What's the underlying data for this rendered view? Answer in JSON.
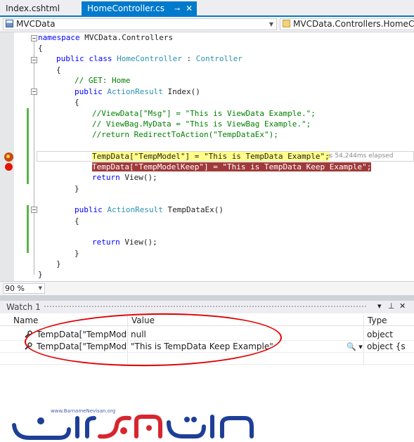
{
  "tabs": {
    "inactive_label": "Index.cshtml",
    "active_label": "HomeController.cs",
    "pin_glyph": "⊸",
    "close_glyph": "✕"
  },
  "navbar": {
    "project": "MVCData",
    "type_member": "MVCData.Controllers.HomeController"
  },
  "code": {
    "l1_kw": "namespace",
    "l1_rest": " MVCData.Controllers",
    "l2": "{",
    "l3_kw": "public class",
    "l3_ty": "HomeController",
    "l3_sep": " : ",
    "l3_base": "Controller",
    "l4": "{",
    "l5": "// GET: Home",
    "l6_kw": "public",
    "l6_ty": "ActionResult",
    "l6_rest": " Index()",
    "l7": "{",
    "l8": "//ViewData[\"Msg\"] = \"This is ViewData Example.\";",
    "l9": "// ViewBag.MyData = \"This is ViewBag Example.\";",
    "l10": "//return RedirectToAction(\"TempDataEx\");",
    "l11_hl": "TempData",
    "l11_a": "[\"TempModel\"] = ",
    "l11_str": "\"This is TempData Example\"",
    "l11_end": ";",
    "l12_hl": "TempData",
    "l12_rest": "[\"TempModelKeep\"] = \"This is TempData Keep Example\";",
    "l13_kw": "return",
    "l13_rest": " View();",
    "l14": "}",
    "l15_kw": "public",
    "l15_ty": "ActionResult",
    "l15_rest": " TempDataEx()",
    "l16": "{",
    "l17_kw": "return",
    "l17_rest": " View();",
    "l18": "}",
    "l19": "}",
    "l20": "}",
    "elapsed": "≤ 54,244ms elapsed"
  },
  "zoom": {
    "value": "90 %"
  },
  "watch": {
    "title": "Watch 1",
    "controls": {
      "dropdown": "▾",
      "pin": "⊥",
      "close": "✕"
    },
    "columns": {
      "name": "Name",
      "value": "Value",
      "type": "Type"
    },
    "rows": [
      {
        "name": "TempData[\"TempModel\"]",
        "value": "null",
        "type": "object"
      },
      {
        "name": "TempData[\"TempModelKeep\"]",
        "value": "\"This is TempData Keep Example\"",
        "type": "object {s"
      }
    ],
    "search_glyph": "🔍 ▾"
  },
  "logo": {
    "url": "www.BarnameNevisan.org"
  },
  "colors": {
    "accent": "#007acc",
    "breakpoint": "#e51400",
    "current_stmt": "#ffff8a",
    "bp_line": "#a03a3a",
    "annotation": "#e00000",
    "logo_blue": "#1e3f96",
    "logo_red": "#d7262e"
  }
}
